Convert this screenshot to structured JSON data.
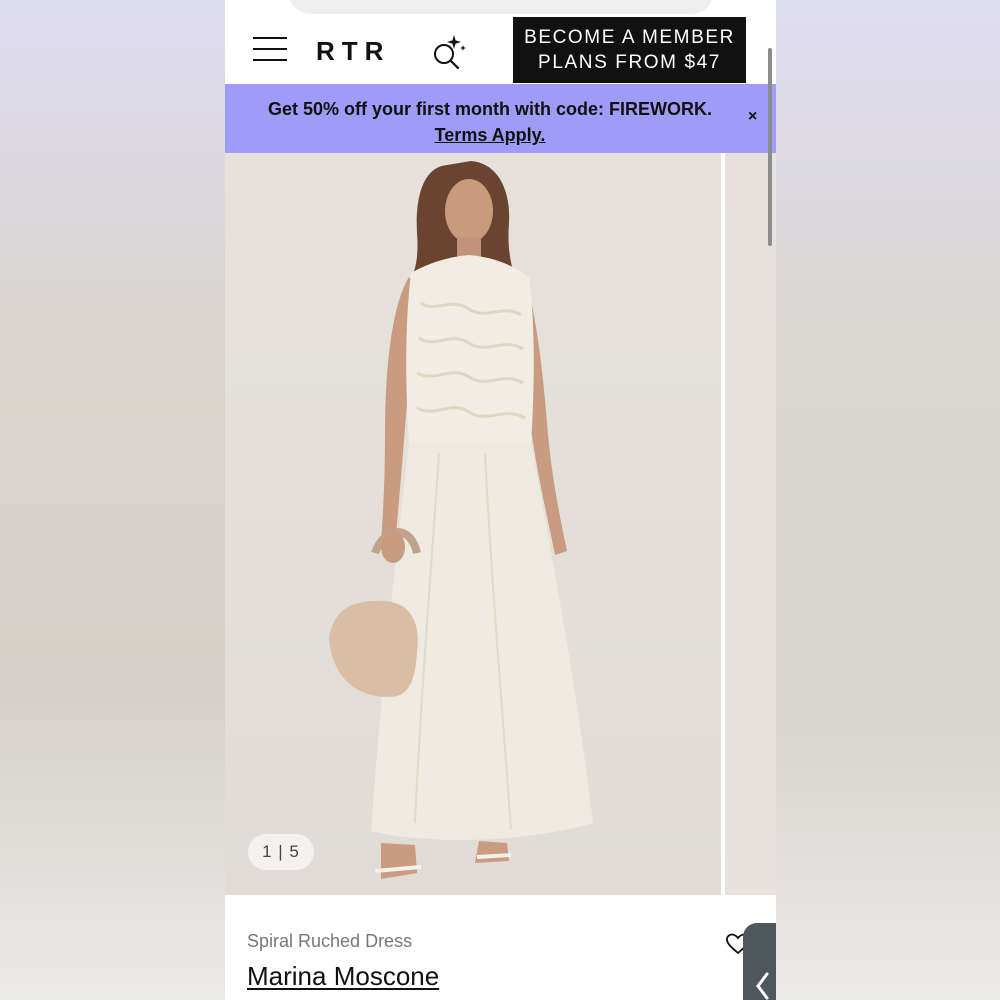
{
  "header": {
    "logo": "RTR",
    "member_cta_line1": "BECOME A MEMBER",
    "member_cta_line2": "PLANS FROM $47"
  },
  "promo": {
    "text": "Get 50% off your first month with code: FIREWORK.",
    "terms": "Terms Apply.",
    "close": "×",
    "background": "#9e9cf7"
  },
  "gallery": {
    "counter": "1 | 5"
  },
  "product": {
    "name": "Spiral Ruched Dress",
    "brand": "Marina Moscone"
  },
  "icons": {
    "menu": "hamburger-menu-icon",
    "search": "ai-search-icon",
    "close": "close-icon",
    "favorite": "heart-icon",
    "side_tab": "chevron-left-icon"
  },
  "colors": {
    "cta_background": "#111111",
    "accent": "#9e9cf7",
    "text_primary": "#111111",
    "text_secondary": "#777777"
  }
}
